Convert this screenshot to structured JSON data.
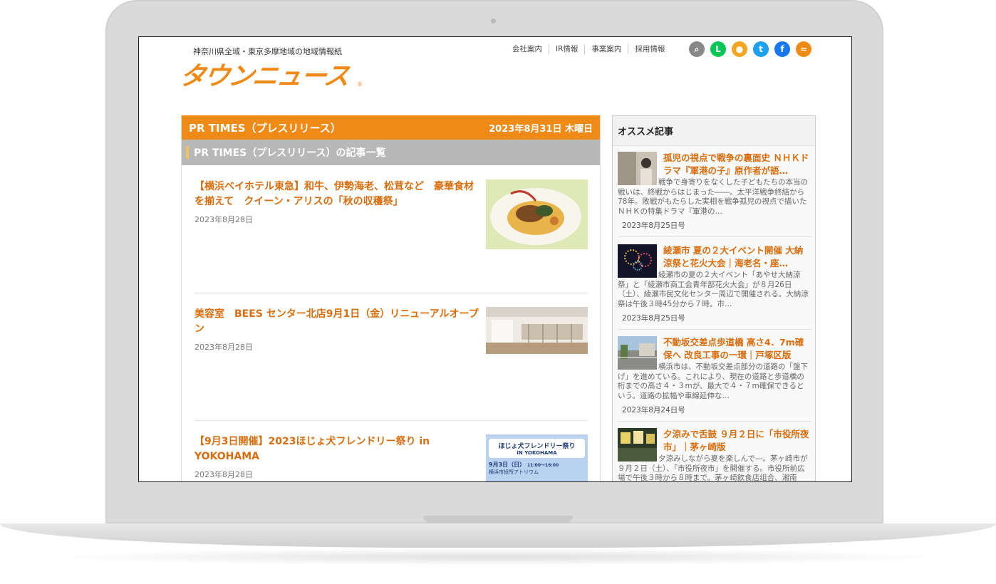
{
  "header": {
    "tagline": "神奈川県全域・東京多摩地域の地域情報紙",
    "logo": "タウンニュース",
    "logo_reg": "®",
    "nav": [
      "会社案内",
      "IR情報",
      "事業案内",
      "採用情報"
    ],
    "social": [
      {
        "name": "search-icon",
        "glyph": "⌕",
        "color": "#888888"
      },
      {
        "name": "line-icon",
        "glyph": "L",
        "color": "#06c755"
      },
      {
        "name": "chat-icon",
        "glyph": "●",
        "color": "#f5a623"
      },
      {
        "name": "twitter-icon",
        "glyph": "t",
        "color": "#1da1f2"
      },
      {
        "name": "facebook-icon",
        "glyph": "f",
        "color": "#1877f2"
      },
      {
        "name": "rss-icon",
        "glyph": "≈",
        "color": "#f08a16"
      }
    ]
  },
  "main": {
    "title": "PR TIMES（プレスリリース）",
    "date": "2023年8月31日 木曜日",
    "section_label": "PR TIMES（プレスリリース）の記事一覧",
    "articles": [
      {
        "title": "【横浜ベイホテル東急】和牛、伊勢海老、松茸など　豪華食材を揃えて　クイーン・アリスの「秋の収穫祭」",
        "date": "2023年8月28日"
      },
      {
        "title": "美容室　BEES センター北店9月1日（金）リニューアルオープン",
        "date": "2023年8月28日"
      },
      {
        "title": "【9月3日開催】2023ほじょ犬フレンドリー祭り in YOKOHAMA",
        "date": "2023年8月28日",
        "poster": {
          "title": "ほじょ犬フレンドリー祭り",
          "sub": "IN YOKOHAMA",
          "day": "9月3日（日）",
          "time": "11:00〜16:00",
          "place": "横浜市役所アトリウム"
        }
      }
    ]
  },
  "sidebar": {
    "title": "オススメ記事",
    "cards": [
      {
        "title": "孤児の視点で戦争の裏面史 ＮＨＫドラマ『軍港の子』原作者が語…",
        "body": "戦争で身寄りをなくした子どもたちの本当の戦いは、終戦からはじまった――。太平洋戦争終結から78年。敗戦がもたらした実相を戦争孤児の視点で描いたＮＨＫの特集ドラマ『軍港の…",
        "date": "2023年8月25日号"
      },
      {
        "title": "綾瀬市 夏の２大イベント開催 大納涼祭と花火大会｜海老名・座…",
        "body": "綾瀬市の夏の２大イベント「あやせ大納涼祭」と「綾瀬市商工会青年部花火大会」が８月26日（土）、綾瀬市民文化センター周辺で開催される。大納涼祭は午後３時45分から７時。市…",
        "date": "2023年8月25日号"
      },
      {
        "title": "不動坂交差点歩道橋 高さ4．7m確保へ 改良工事の一環｜戸塚区版",
        "body": "横浜市は、不動坂交差点部分の道路の「盤下げ」を進めている。これにより、現在の道路と歩道橋の桁までの高さ４・３mが、最大で４・７m確保できるという。道路の拡幅や車線延伸な…",
        "date": "2023年8月24日号"
      },
      {
        "title": "夕涼みで舌鼓 ９月２日に「市役所夜市」｜茅ヶ崎版",
        "body": "夕涼みしながら夏を楽しんで―。茅ヶ崎市が９月２日（土）、「市役所夜市」を開催する。市役所前広場で午後３時から８時まで。茅ヶ崎飲食店组合、湘南",
        "date": ""
      }
    ]
  }
}
